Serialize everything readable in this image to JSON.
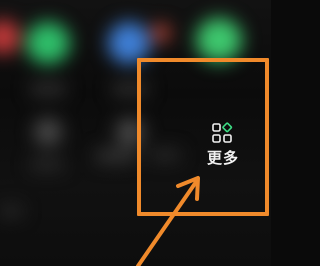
{
  "more_tile": {
    "label": "更多",
    "icon": "more-grid-icon"
  },
  "colors": {
    "annotation_orange": "#f08a2b",
    "background": "#0a0a0a",
    "icon_green": "#3ddc84",
    "label_text": "#f2f2f2"
  }
}
